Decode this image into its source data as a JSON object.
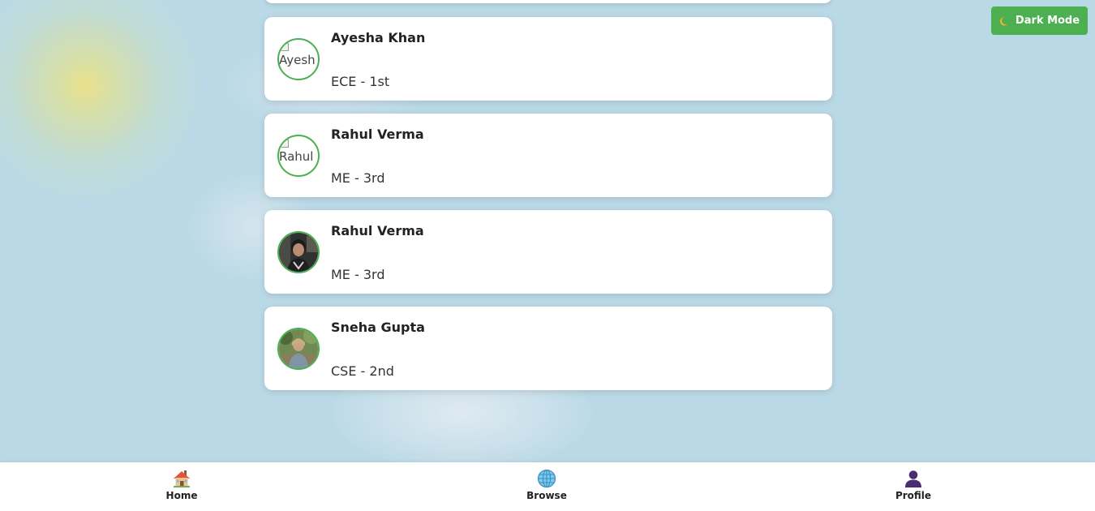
{
  "theme_toggle": {
    "label": "Dark Mode",
    "icon": "moon-icon",
    "color": "#4caf50"
  },
  "students": [
    {
      "name": "Ayesha Khan",
      "dept": "ECE - 1st",
      "avatar_alt": "Ayesh",
      "avatar_loaded": false
    },
    {
      "name": "Rahul Verma",
      "dept": "ME - 3rd",
      "avatar_alt": "Rahul",
      "avatar_loaded": false
    },
    {
      "name": "Rahul Verma",
      "dept": "ME - 3rd",
      "avatar_alt": "",
      "avatar_loaded": true
    },
    {
      "name": "Sneha Gupta",
      "dept": "CSE - 2nd",
      "avatar_alt": "",
      "avatar_loaded": true
    }
  ],
  "bottom_nav": [
    {
      "label": "Home",
      "icon": "house-icon"
    },
    {
      "label": "Browse",
      "icon": "globe-icon"
    },
    {
      "label": "Profile",
      "icon": "person-icon"
    }
  ],
  "colors": {
    "avatar_border": "#4caf50",
    "background": "#bad9e6"
  }
}
